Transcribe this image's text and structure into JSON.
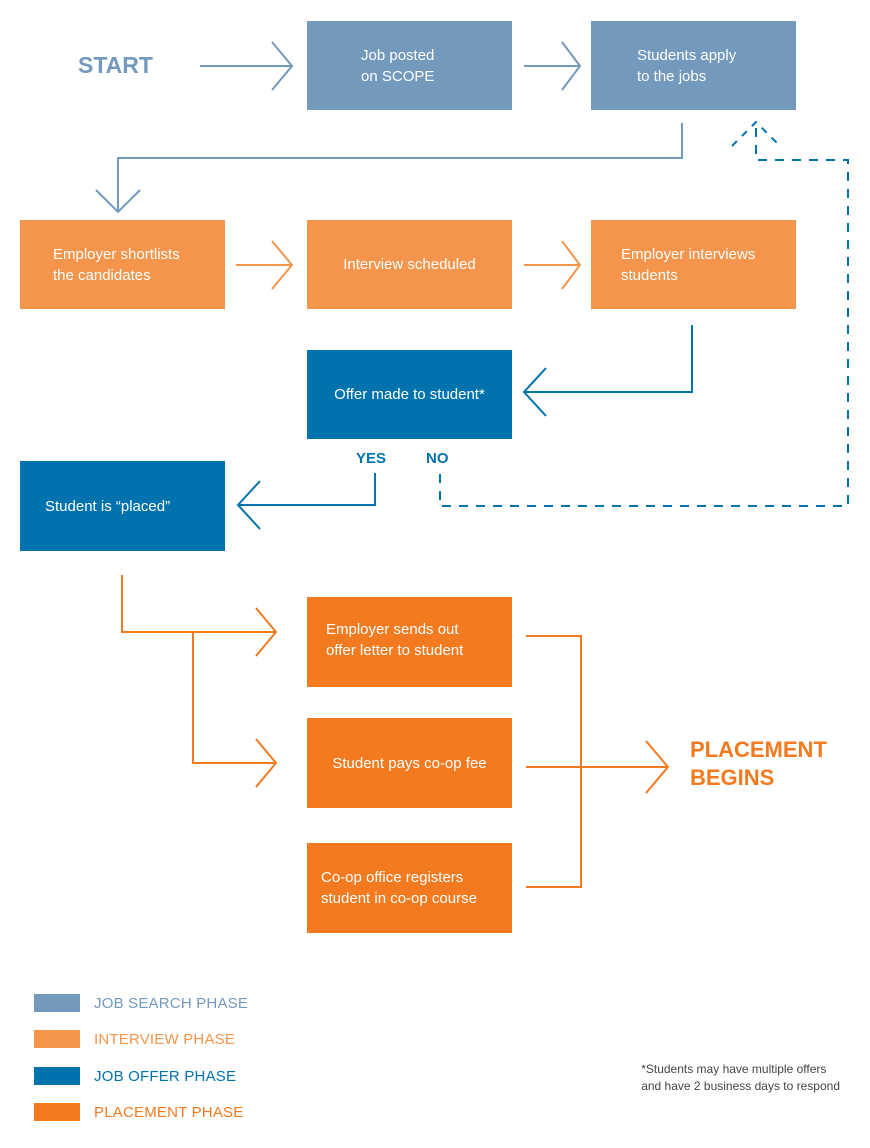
{
  "colors": {
    "job_search": "#7399bd",
    "interview": "#f4954b",
    "job_offer": "#0072ae",
    "placement": "#f47a20"
  },
  "start_label": "START",
  "end_label": "PLACEMENT\nBEGINS",
  "steps": {
    "job_posted": "Job posted\non SCOPE",
    "students_apply": "Students apply\nto the jobs",
    "shortlist": "Employer shortlists\nthe candidates",
    "interview_scheduled": "Interview scheduled",
    "employer_interviews": "Employer interviews\nstudents",
    "offer_made": "Offer made to student*",
    "student_placed": "Student is “placed”",
    "offer_letter": "Employer sends out\noffer letter to student",
    "pays_fee": "Student pays co-op fee",
    "registers": "Co-op office registers\nstudent in co-op course"
  },
  "decision": {
    "yes": "YES",
    "no": "NO"
  },
  "legend": [
    {
      "label": "JOB SEARCH PHASE",
      "color": "#7399bd"
    },
    {
      "label": "INTERVIEW PHASE",
      "color": "#f4954b"
    },
    {
      "label": "JOB OFFER PHASE",
      "color": "#0072ae"
    },
    {
      "label": "PLACEMENT PHASE",
      "color": "#f47a20"
    }
  ],
  "footnote": "*Students may have multiple offers\n  and have 2 business days to respond"
}
